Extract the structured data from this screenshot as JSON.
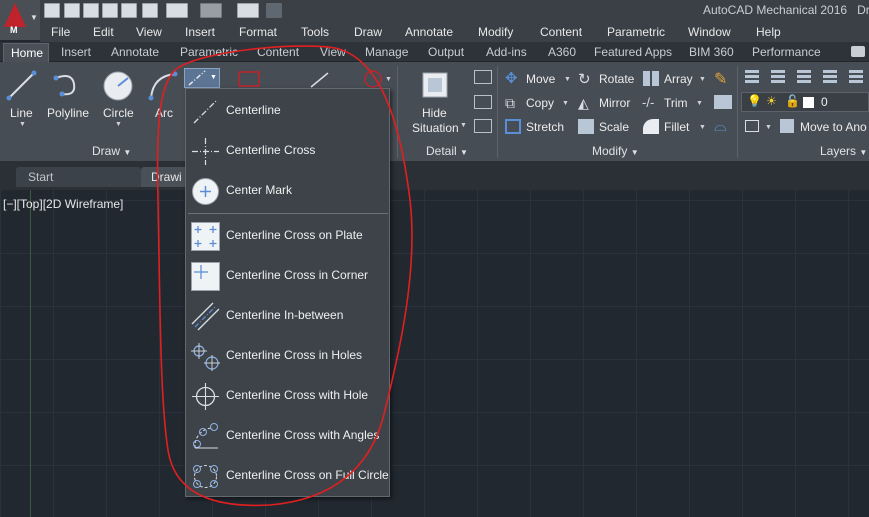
{
  "title_bar": {
    "title": "AutoCAD Mechanical 2016",
    "drawing": "Dr"
  },
  "app_button": {
    "letter": "M"
  },
  "menu": [
    "File",
    "Edit",
    "View",
    "Insert",
    "Format",
    "Tools",
    "Draw",
    "Annotate",
    "Modify",
    "Content",
    "Parametric",
    "Window",
    "Help"
  ],
  "ribbon_tabs": {
    "active": "Home",
    "items": [
      "Insert",
      "Annotate",
      "Parametric",
      "Content",
      "View",
      "Manage",
      "Output",
      "Add-ins",
      "A360",
      "Featured Apps",
      "BIM 360",
      "Performance"
    ]
  },
  "draw_panel": {
    "title": "Draw",
    "line": "Line",
    "polyline": "Polyline",
    "circle": "Circle",
    "arc": "Arc"
  },
  "detail_panel": {
    "title": "Detail",
    "hide_situation_1": "Hide",
    "hide_situation_2": "Situation"
  },
  "modify_panel": {
    "title": "Modify",
    "move": "Move",
    "rotate": "Rotate",
    "array": "Array",
    "copy": "Copy",
    "mirror": "Mirror",
    "trim": "Trim",
    "stretch": "Stretch",
    "scale": "Scale",
    "fillet": "Fillet"
  },
  "layers_panel": {
    "title": "Layers",
    "layer_value": "0",
    "move_to": "Move to Ano"
  },
  "doc_tabs": {
    "start": "Start",
    "drawing": "Drawi"
  },
  "viewport": {
    "label": "[−][Top][2D Wireframe]"
  },
  "centerline_menu": {
    "items": [
      {
        "label": "Centerline",
        "icon": "centerline-icon"
      },
      {
        "label": "Centerline Cross",
        "icon": "centerline-cross-icon"
      },
      {
        "label": "Center Mark",
        "icon": "center-mark-icon"
      },
      {
        "label": "Centerline Cross on Plate",
        "icon": "cross-on-plate-icon"
      },
      {
        "label": "Centerline Cross in Corner",
        "icon": "cross-in-corner-icon"
      },
      {
        "label": "Centerline In-between",
        "icon": "in-between-icon"
      },
      {
        "label": "Centerline Cross in Holes",
        "icon": "cross-in-holes-icon"
      },
      {
        "label": "Centerline Cross with Hole",
        "icon": "cross-with-hole-icon"
      },
      {
        "label": "Centerline Cross with Angles",
        "icon": "cross-with-angles-icon"
      },
      {
        "label": "Centerline Cross on Full Circle",
        "icon": "cross-on-full-circle-icon"
      }
    ]
  },
  "colors": {
    "annotation": "#e02020",
    "accent_blue": "#5a8fd8"
  }
}
